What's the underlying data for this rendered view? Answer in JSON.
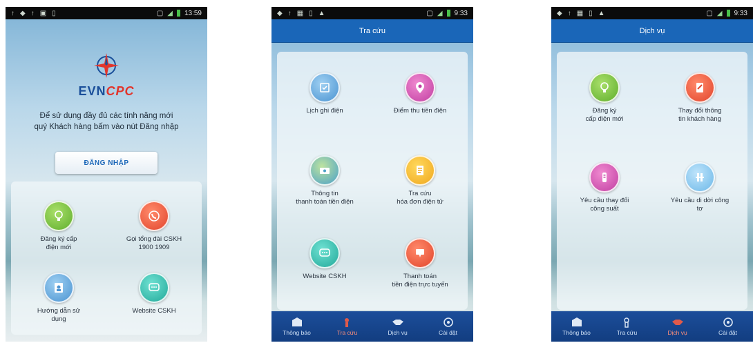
{
  "status_bar": {
    "time_1": "13:59",
    "time_2": "9:33",
    "time_3": "9:33"
  },
  "screen1": {
    "brand_evn": "EVN",
    "brand_cpc": "CPC",
    "message_line1": "Để sử dụng đầy đủ các tính năng mới",
    "message_line2": "quý Khách hàng bấm vào nút Đăng nhập",
    "login_label": "ĐĂNG NHẬP",
    "tiles": [
      {
        "label_1": "Đăng ký cấp",
        "label_2": "điện mới",
        "icon": "lightbulb-icon"
      },
      {
        "label_1": "Gọi tổng đài CSKH",
        "label_2": "1900 1909",
        "icon": "phone-icon"
      },
      {
        "label_1": "Hướng dẫn sử",
        "label_2": "dụng",
        "icon": "guide-icon"
      },
      {
        "label_1": "Website CSKH",
        "label_2": "",
        "icon": "chat-icon"
      }
    ]
  },
  "screen2": {
    "title": "Tra cứu",
    "tiles": [
      {
        "label_1": "Lịch ghi điện",
        "label_2": "",
        "icon": "calendar-icon"
      },
      {
        "label_1": "Điểm thu tiền điện",
        "label_2": "",
        "icon": "location-pin-icon"
      },
      {
        "label_1": "Thông tin",
        "label_2": "thanh toán tiền điện",
        "icon": "payment-info-icon"
      },
      {
        "label_1": "Tra cứu",
        "label_2": "hóa đơn điện tử",
        "icon": "invoice-icon"
      },
      {
        "label_1": "Website CSKH",
        "label_2": "",
        "icon": "chat-icon"
      },
      {
        "label_1": "Thanh toán",
        "label_2": "tiền điện trực tuyến",
        "icon": "online-payment-icon"
      }
    ]
  },
  "screen3": {
    "title": "Dịch vụ",
    "tiles": [
      {
        "label_1": "Đăng ký",
        "label_2": "cấp điện mới",
        "icon": "lightbulb-icon"
      },
      {
        "label_1": "Thay đổi thông",
        "label_2": "tin khách hàng",
        "icon": "edit-document-icon"
      },
      {
        "label_1": "Yêu cầu thay đổi",
        "label_2": "công suất",
        "icon": "power-meter-icon"
      },
      {
        "label_1": "Yêu cầu di dời công",
        "label_2": "tơ",
        "icon": "meter-relocate-icon"
      }
    ]
  },
  "tabs": [
    {
      "label": "Thông báo",
      "icon": "notification-icon"
    },
    {
      "label": "Tra cứu",
      "icon": "lookup-icon"
    },
    {
      "label": "Dịch vụ",
      "icon": "handshake-icon"
    },
    {
      "label": "Cài đặt",
      "icon": "gear-icon"
    }
  ],
  "colors": {
    "title_bar": "#1a66b8",
    "tab_bar": "#1c4e9a",
    "active_tab": "#ff8f7a",
    "brand_red": "#e2342b",
    "brand_blue": "#1a4f9a"
  }
}
